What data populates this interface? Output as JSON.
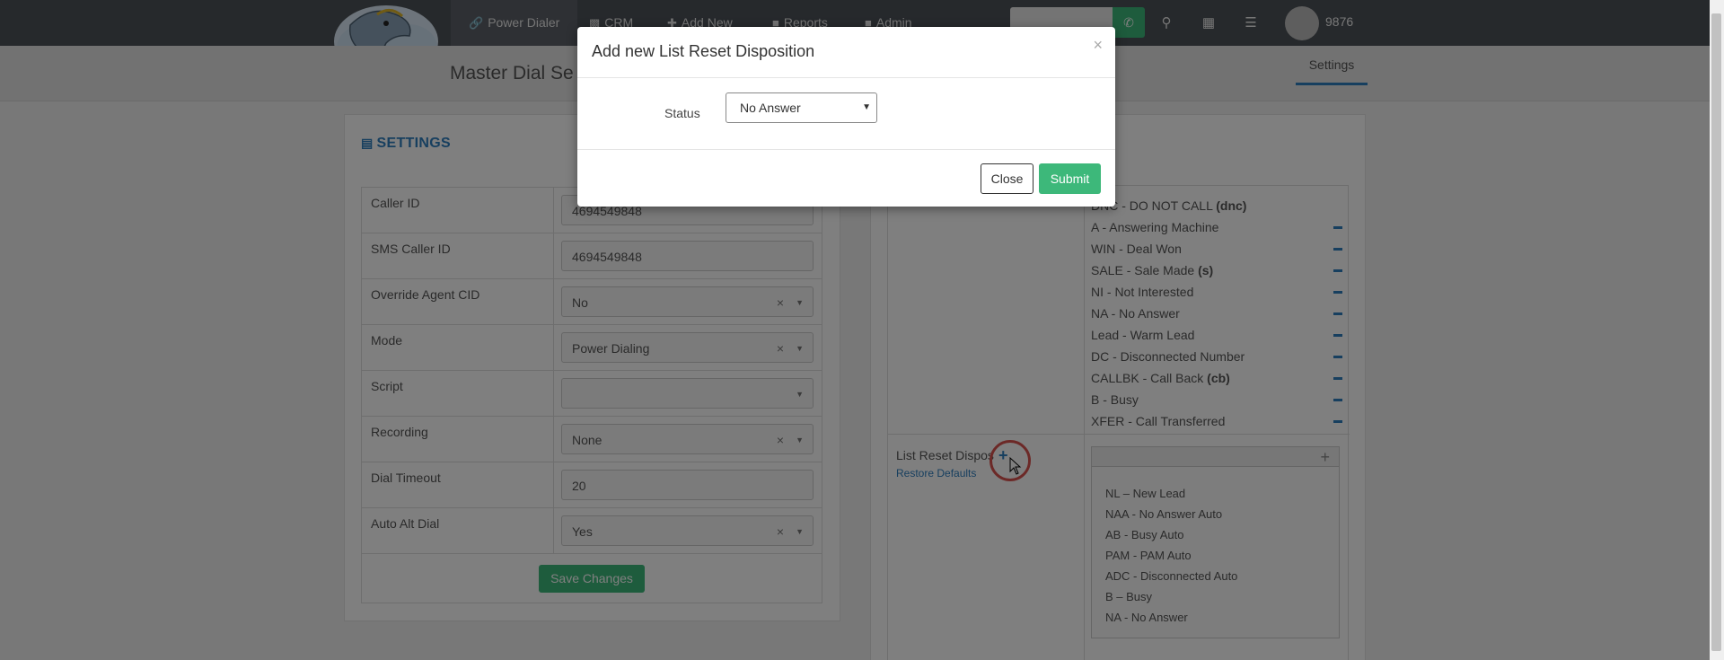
{
  "navbar": {
    "items": [
      {
        "label": "Power Dialer",
        "icon": "link-icon"
      },
      {
        "label": "CRM",
        "icon": "book-icon"
      },
      {
        "label": "Add New",
        "icon": "plus-icon"
      },
      {
        "label": "Reports",
        "icon": "lock-icon"
      },
      {
        "label": "Admin",
        "icon": "lock-icon"
      }
    ],
    "user_number": "9876"
  },
  "page": {
    "title": "Master Dial Se",
    "tab_settings": "Settings"
  },
  "settings": {
    "title": "SETTINGS",
    "rows": [
      {
        "label": "Caller ID",
        "value": "4694549848"
      },
      {
        "label": "SMS Caller ID",
        "value": "4694549848"
      },
      {
        "label": "Override Agent CID",
        "value": "No"
      },
      {
        "label": "Mode",
        "value": "Power Dialing"
      },
      {
        "label": "Script",
        "value": ""
      },
      {
        "label": "Recording",
        "value": "None"
      },
      {
        "label": "Dial Timeout",
        "value": "20"
      },
      {
        "label": "Auto Alt Dial",
        "value": "Yes"
      }
    ],
    "save_label": "Save Changes"
  },
  "dispositions": {
    "items": [
      {
        "text": "DNC - DO NOT CALL",
        "tag": "(dnc)"
      },
      {
        "text": "A - Answering Machine",
        "tag": ""
      },
      {
        "text": "WIN - Deal Won",
        "tag": ""
      },
      {
        "text": "SALE - Sale Made",
        "tag": "(s)"
      },
      {
        "text": "NI - Not Interested",
        "tag": ""
      },
      {
        "text": "NA - No Answer",
        "tag": ""
      },
      {
        "text": "Lead - Warm Lead",
        "tag": ""
      },
      {
        "text": "DC - Disconnected Number",
        "tag": ""
      },
      {
        "text": "CALLBK - Call Back",
        "tag": "(cb)"
      },
      {
        "text": "B - Busy",
        "tag": ""
      },
      {
        "text": "XFER - Call Transferred",
        "tag": ""
      }
    ]
  },
  "list_reset": {
    "label": "List Reset Dispos",
    "restore_label": "Restore Defaults",
    "items": [
      "NL – New Lead",
      "NAA - No Answer Auto",
      "AB - Busy Auto",
      "PAM - PAM Auto",
      "ADC - Disconnected Auto",
      "B – Busy",
      "NA - No Answer"
    ]
  },
  "modal": {
    "title": "Add new List Reset Disposition",
    "status_label": "Status",
    "status_value": "No Answer",
    "close_label": "Close",
    "submit_label": "Submit"
  },
  "colors": {
    "accent": "#2e7ebf",
    "success": "#3db87a",
    "navbar": "#4d5258"
  }
}
